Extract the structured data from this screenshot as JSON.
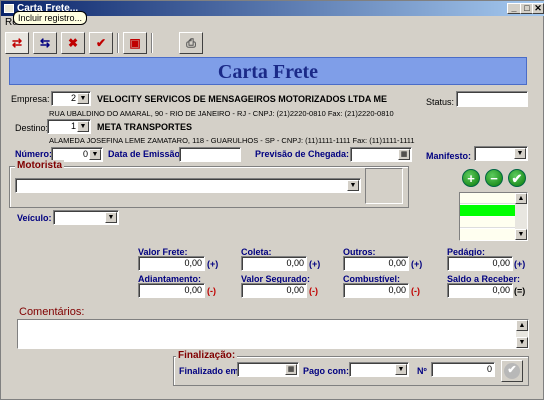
{
  "window": {
    "title": "Carta Frete...",
    "minimize": "_",
    "maximize": "□",
    "close": "✕"
  },
  "menu": {
    "first": "Re"
  },
  "tooltip": "Incluir registro...",
  "banner": "Carta Frete",
  "empresa": {
    "label": "Empresa:",
    "code": "2",
    "name": "VELOCITY SERVICOS DE MENSAGEIROS MOTORIZADOS LTDA ME",
    "address": "RUA UBALDINO DO AMARAL, 90 - RIO DE JANEIRO - RJ - CNPJ: (21)2220-0810 Fax: (21)2220-0810"
  },
  "status": {
    "label": "Status:",
    "value": ""
  },
  "destino": {
    "label": "Destino:",
    "code": "1",
    "name": "META TRANSPORTES",
    "address": "ALAMEDA JOSEFINA LEME ZAMATARO, 118 - GUARULHOS - SP - CNPJ: (11)1111-1111 Fax: (11)1111-1111"
  },
  "numero": {
    "label": "Número:",
    "value": "0"
  },
  "emissao": {
    "label": "Data de Emissão:",
    "value": ""
  },
  "chegada": {
    "label": "Previsão de Chegada:",
    "value": ""
  },
  "manifesto": {
    "label": "Manifesto:",
    "value": ""
  },
  "motorista": {
    "label": "Motorista",
    "value": ""
  },
  "veiculo": {
    "label": "Veículo:",
    "value": ""
  },
  "valores": {
    "frete": {
      "label": "Valor Frete:",
      "value": "0,00",
      "sign": "(+)"
    },
    "coleta": {
      "label": "Coleta:",
      "value": "0,00",
      "sign": "(+)"
    },
    "outros": {
      "label": "Outros:",
      "value": "0,00",
      "sign": "(+)"
    },
    "pedagio": {
      "label": "Pedágio:",
      "value": "0,00",
      "sign": "(+)"
    },
    "adiantamento": {
      "label": "Adiantamento:",
      "value": "0,00",
      "sign": "(-)"
    },
    "seguro": {
      "label": "Valor Segurado:",
      "value": "0,00",
      "sign": "(-)"
    },
    "combustivel": {
      "label": "Combustível:",
      "value": "0,00",
      "sign": "(-)"
    },
    "saldo": {
      "label": "Saldo a Receber:",
      "value": "0,00",
      "sign": "(=)"
    }
  },
  "comentarios": {
    "label": "Comentários:",
    "value": ""
  },
  "finalizacao": {
    "title": "Finalização:",
    "finalizado_label": "Finalizado em:",
    "finalizado_value": "",
    "pago_label": "Pago com:",
    "pago_value": "",
    "n_label": "Nº",
    "n_value": "0"
  },
  "colors": {
    "banner_bg": "#7f9ee8",
    "banner_text": "#1b2a88",
    "group_title": "#800000",
    "green": "#0a7a0a",
    "list_selected": "#00ff00"
  },
  "icons": [
    "include-icon",
    "edit-icon",
    "delete-icon",
    "confirm-icon",
    "calculator-icon",
    "print-icon"
  ]
}
